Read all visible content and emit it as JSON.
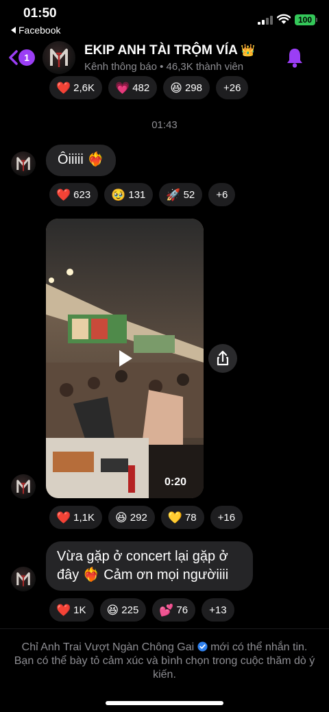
{
  "status_bar": {
    "time": "01:50",
    "back_app": "Facebook",
    "battery": "100"
  },
  "header": {
    "unread_count": "1",
    "channel_name": "EKIP ANH TÀI TRỘM VÍA",
    "crown_emoji": "👑",
    "subtitle": "Kênh thông báo • 46,3K thành viên",
    "accent_color": "#9b3ef5"
  },
  "timestamp": "01:43",
  "reactions_top": [
    {
      "emoji": "❤️",
      "count": "2,6K"
    },
    {
      "emoji": "💗",
      "count": "482"
    },
    {
      "emoji": "😆",
      "count": "298"
    },
    {
      "emoji": "",
      "count": "+26"
    }
  ],
  "messages": [
    {
      "text": "Ôiiiii ❤️‍🔥",
      "reactions": [
        {
          "emoji": "❤️",
          "count": "623"
        },
        {
          "emoji": "🥹",
          "count": "131"
        },
        {
          "emoji": "🚀",
          "count": "52"
        },
        {
          "emoji": "",
          "count": "+6"
        }
      ]
    },
    {
      "video_duration": "0:20",
      "reactions": [
        {
          "emoji": "❤️",
          "count": "1,1K"
        },
        {
          "emoji": "😆",
          "count": "292"
        },
        {
          "emoji": "💛",
          "count": "78"
        },
        {
          "emoji": "",
          "count": "+16"
        }
      ]
    },
    {
      "text_line1": "Vừa gặp ở concert lại gặp ở",
      "text_line2": "đây ❤️‍🔥 Cảm ơn mọi ngườiiii",
      "reactions": [
        {
          "emoji": "❤️",
          "count": "1K"
        },
        {
          "emoji": "😆",
          "count": "225"
        },
        {
          "emoji": "💕",
          "count": "76"
        },
        {
          "emoji": "",
          "count": "+13"
        }
      ]
    }
  ],
  "footer": {
    "admin_name": "Chỉ Anh Trai Vượt Ngàn Chông Gai",
    "note_rest": " mới có thể nhắn tin. Bạn có thể bày tỏ cảm xúc và bình chọn trong cuộc thăm dò ý kiến."
  },
  "icons": [
    "signal-icon",
    "wifi-icon",
    "battery-icon",
    "back-chevron-icon",
    "bell-icon",
    "play-icon",
    "share-icon",
    "verified-icon"
  ]
}
